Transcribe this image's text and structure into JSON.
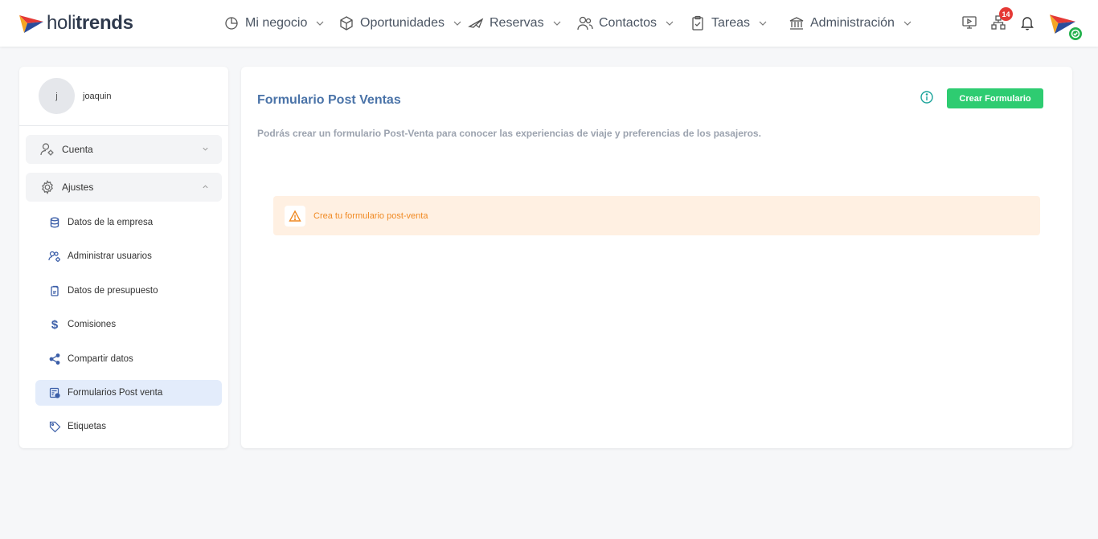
{
  "brand": {
    "light": "holi",
    "bold": "trends"
  },
  "nav": [
    {
      "label": "Mi negocio",
      "icon": "pie-chart-icon"
    },
    {
      "label": "Oportunidades",
      "icon": "cube-icon"
    },
    {
      "label": "Reservas",
      "icon": "plane-icon"
    },
    {
      "label": "Contactos",
      "icon": "users-icon"
    },
    {
      "label": "Tareas",
      "icon": "clipboard-icon"
    },
    {
      "label": "Administración",
      "icon": "bank-icon"
    }
  ],
  "top_right": {
    "notifications_count": "14"
  },
  "user": {
    "initial": "j",
    "name": "joaquin"
  },
  "sidebar": {
    "groups": [
      {
        "label": "Cuenta",
        "icon": "user-gear-icon",
        "expanded": false
      },
      {
        "label": "Ajustes",
        "icon": "gear-icon",
        "expanded": true
      }
    ],
    "items": [
      {
        "label": "Datos de la empresa",
        "icon": "database-icon"
      },
      {
        "label": "Administrar usuarios",
        "icon": "users-gear-icon"
      },
      {
        "label": "Datos de presupuesto",
        "icon": "document-icon"
      },
      {
        "label": "Comisiones",
        "icon": "dollar-icon"
      },
      {
        "label": "Compartir datos",
        "icon": "share-icon"
      },
      {
        "label": "Formularios Post venta",
        "icon": "form-icon",
        "active": true
      },
      {
        "label": "Etiquetas",
        "icon": "tag-icon"
      }
    ]
  },
  "main": {
    "title": "Formulario Post Ventas",
    "create_button": "Crear Formulario",
    "description": "Podrás crear un formulario Post-Venta para conocer las experiencias de viaje y preferencias de los pasajeros.",
    "alert": "Crea tu formulario post-venta"
  },
  "colors": {
    "accent_blue": "#4a73a8",
    "button_green": "#2ecc71",
    "alert_bg": "#fff0e2",
    "alert_text": "#f08a24",
    "badge_red": "#e53935"
  }
}
